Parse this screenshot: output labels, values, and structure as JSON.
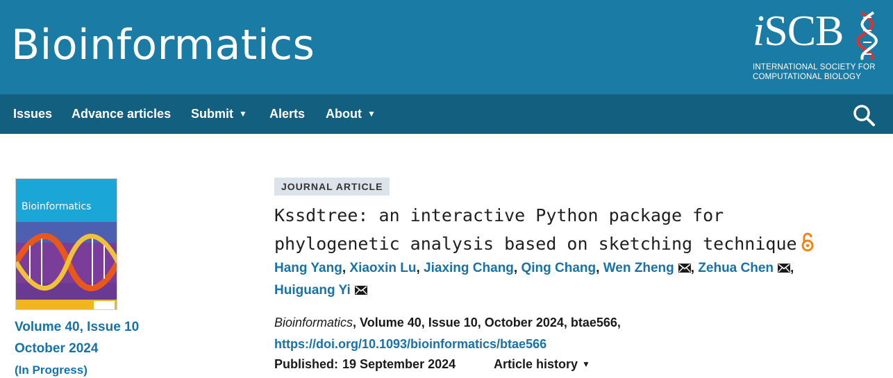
{
  "header": {
    "journal_title": "Bioinformatics",
    "logo": {
      "wordmark_i": "i",
      "wordmark_rest": "SCB",
      "line1": "INTERNATIONAL SOCIETY FOR",
      "line2": "COMPUTATIONAL BIOLOGY",
      "colors": {
        "helix_red": "#e0312f",
        "white": "#ffffff"
      }
    },
    "background_color": "#1a7ba5"
  },
  "nav": {
    "background_color": "#135f80",
    "items": [
      {
        "label": "Issues",
        "dropdown": false
      },
      {
        "label": "Advance articles",
        "dropdown": false
      },
      {
        "label": "Submit",
        "dropdown": true
      },
      {
        "label": "Alerts",
        "dropdown": false
      },
      {
        "label": "About",
        "dropdown": true
      }
    ],
    "caret_glyph": "▼",
    "search_icon": "search-icon"
  },
  "sidebar": {
    "cover_title": "Bioinformatics",
    "volume_issue": "Volume 40, Issue 10",
    "issue_date": "October 2024",
    "status": "(In Progress)"
  },
  "article": {
    "type_badge": "JOURNAL ARTICLE",
    "title_line1": "Kssdtree: an interactive Python package for",
    "title_line2": "phylogenetic analysis based on sketching technique",
    "open_access_icon": "open-access-icon",
    "authors": [
      {
        "name": "Hang Yang",
        "mail": false
      },
      {
        "name": "Xiaoxin Lu",
        "mail": false
      },
      {
        "name": "Jiaxing Chang",
        "mail": false
      },
      {
        "name": "Qing Chang",
        "mail": false
      },
      {
        "name": "Wen Zheng",
        "mail": true
      },
      {
        "name": "Zehua Chen",
        "mail": true
      },
      {
        "name": "Huiguang Yi",
        "mail": true
      }
    ],
    "separator": ",",
    "citation": {
      "journal": "Bioinformatics",
      "details": ", Volume 40, Issue 10, October 2024, btae566,",
      "doi": "https://doi.org/10.1093/bioinformatics/btae566"
    },
    "published_label": "Published:",
    "published_date": "19 September 2024",
    "history_label": "Article history",
    "link_color": "#1672a8"
  }
}
